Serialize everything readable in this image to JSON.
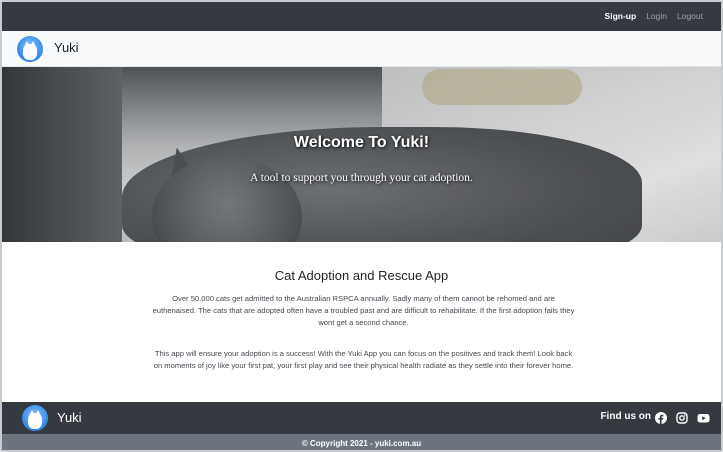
{
  "topnav": {
    "items": [
      {
        "label": "Sign-up",
        "active": true
      },
      {
        "label": "Login",
        "active": false
      },
      {
        "label": "Logout",
        "active": false
      }
    ]
  },
  "header": {
    "brand": "Yuki",
    "logo_icon": "cat-avatar-icon"
  },
  "hero": {
    "title": "Welcome To Yuki!",
    "subtitle": "A tool to support you through your cat adoption."
  },
  "main": {
    "heading": "Cat Adoption and Rescue App",
    "paragraph1": "Over 50.000 cats get admitted to the Australian RSPCA annually. Sadly many of them cannot be rehomed and are euthenaised. The cats that are adopted often have a troubled past and are difficult to rehabilitate. If the first adoption fails they wont get a second chance.",
    "paragraph2": "This app will ensure your adoption is a success! With the Yuki App you can focus on the positives and track them! Look back on moments of joy like your first pat, your first play and see their physical health radiate as they settle into their forever home."
  },
  "footer": {
    "brand": "Yuki",
    "find_us": "Find us on",
    "socials": [
      "facebook-icon",
      "instagram-icon",
      "youtube-icon"
    ],
    "copyright": "© Copyright 2021 - yuki.com.au"
  },
  "colors": {
    "dark_bar": "#343a40",
    "light_bar": "#f8f9fa",
    "copyright_bar": "#6c757d",
    "logo_blue": "#3b8ee8"
  }
}
